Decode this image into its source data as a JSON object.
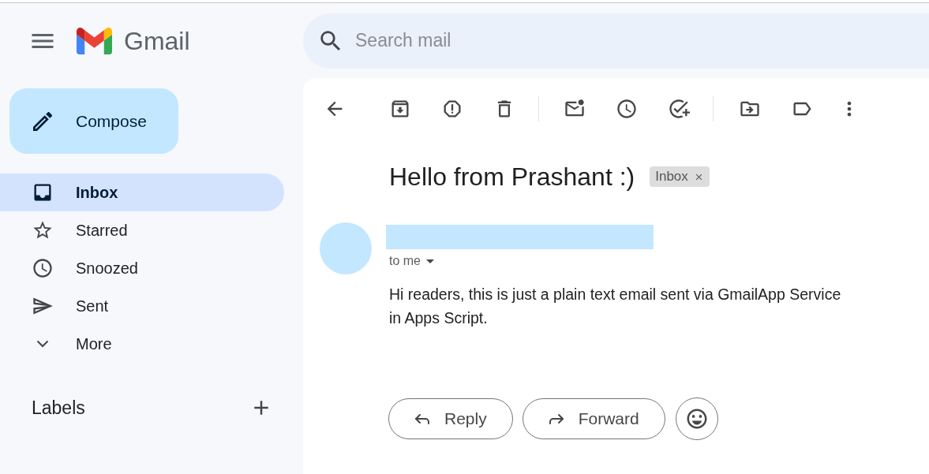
{
  "header": {
    "app_name": "Gmail",
    "search": {
      "placeholder": "Search mail"
    }
  },
  "sidebar": {
    "compose": {
      "label": "Compose"
    },
    "items": [
      {
        "label": "Inbox",
        "selected": true
      },
      {
        "label": "Starred",
        "selected": false
      },
      {
        "label": "Snoozed",
        "selected": false
      },
      {
        "label": "Sent",
        "selected": false
      },
      {
        "label": "More",
        "selected": false
      }
    ],
    "labels_heading": "Labels"
  },
  "message": {
    "subject": "Hello from Prashant :)",
    "tags": [
      {
        "label": "Inbox"
      }
    ],
    "recipient": "to me",
    "body": "Hi readers, this is just a plain text email sent via GmailApp Service in Apps Script."
  },
  "actions": [
    {
      "label": "Reply"
    },
    {
      "label": "Forward"
    }
  ]
}
